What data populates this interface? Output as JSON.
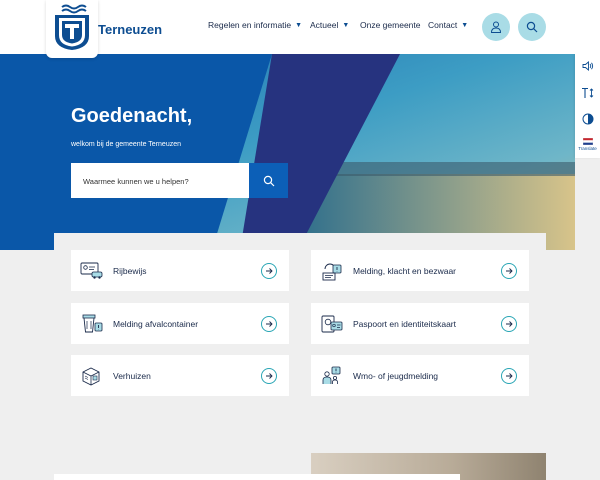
{
  "header": {
    "site_name": "Terneuzen",
    "nav": [
      {
        "label": "Regelen en informatie",
        "has_dropdown": true
      },
      {
        "label": "Actueel",
        "has_dropdown": true
      },
      {
        "label": "Onze gemeente",
        "has_dropdown": false
      },
      {
        "label": "Contact",
        "has_dropdown": true
      }
    ],
    "account_icon": "user-icon",
    "search_icon": "search-icon"
  },
  "hero": {
    "greeting": "Goedenacht,",
    "subtitle": "welkom bij de gemeente Terneuzen",
    "search_placeholder": "Waarmee kunnen we u helpen?"
  },
  "side_toolbar": {
    "items": [
      "speaker-icon",
      "text-size-icon",
      "contrast-icon",
      "flag-icon"
    ],
    "translate_label": "Translate"
  },
  "tiles": [
    {
      "label": "Rijbewijs",
      "icon": "drivers-license-icon"
    },
    {
      "label": "Melding, klacht en bezwaar",
      "icon": "report-icon"
    },
    {
      "label": "Melding afvalcontainer",
      "icon": "waste-container-icon"
    },
    {
      "label": "Paspoort en identiteitskaart",
      "icon": "passport-icon"
    },
    {
      "label": "Verhuizen",
      "icon": "moving-box-icon"
    },
    {
      "label": "Wmo- of jeugdmelding",
      "icon": "family-icon"
    }
  ],
  "colors": {
    "brand_blue": "#0d4d91",
    "hero_blue": "#0a57a8",
    "hero_navy": "#26337f",
    "accent_teal": "#2aa6b5",
    "round_button": "#a9dce6"
  }
}
